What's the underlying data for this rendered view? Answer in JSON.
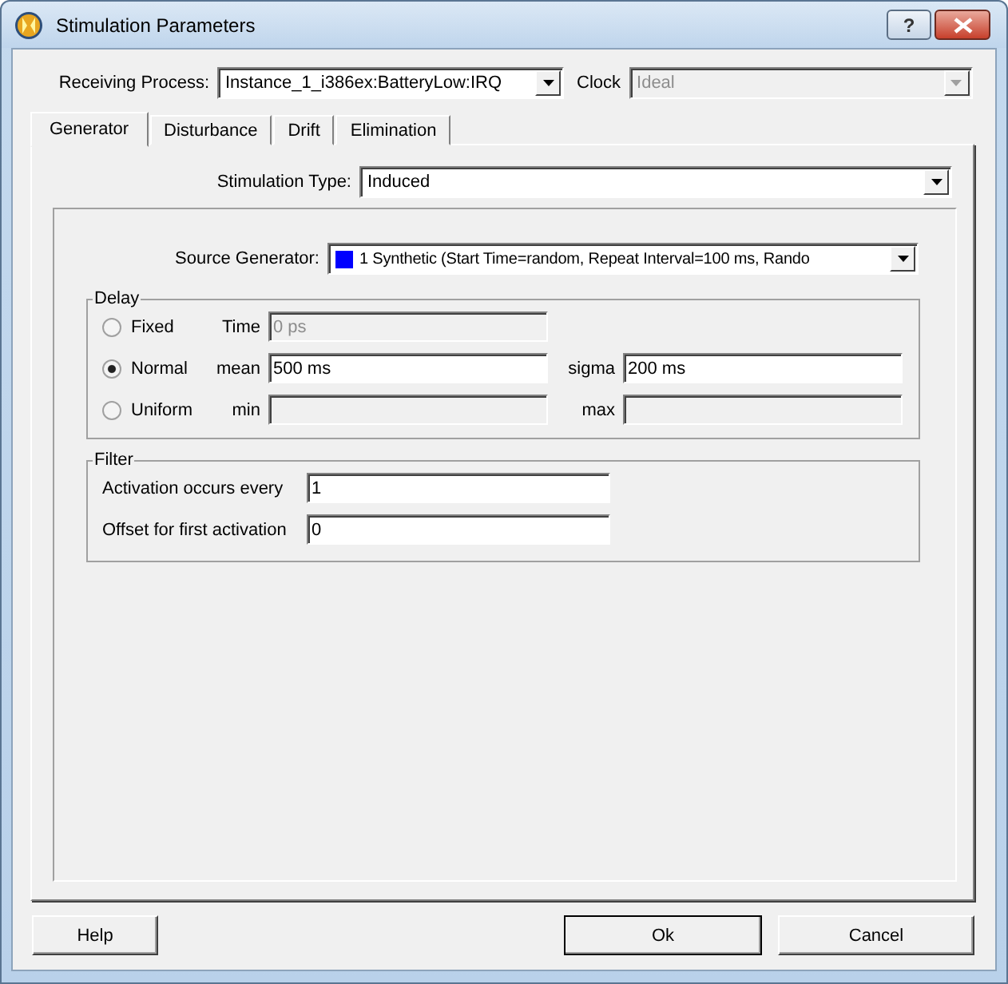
{
  "window": {
    "title": "Stimulation Parameters",
    "help_button": "?"
  },
  "receiving_process": {
    "label": "Receiving Process:",
    "value": "Instance_1_i386ex:BatteryLow:IRQ",
    "disabled": false
  },
  "clock": {
    "label": "Clock",
    "value": "Ideal",
    "disabled": true
  },
  "tabs": [
    {
      "label": "Generator",
      "selected": true
    },
    {
      "label": "Disturbance",
      "selected": false
    },
    {
      "label": "Drift",
      "selected": false
    },
    {
      "label": "Elimination",
      "selected": false
    }
  ],
  "stimulation_type": {
    "label": "Stimulation Type:",
    "value": "Induced",
    "disabled": false
  },
  "source_generator": {
    "label": "Source Generator:",
    "value": "1 Synthetic (Start Time=random, Repeat Interval=100 ms, Rando",
    "color": "#0000ff",
    "disabled": false
  },
  "delay": {
    "title": "Delay",
    "options": [
      {
        "label": "Fixed",
        "selected": false,
        "fields": [
          {
            "label": "Time",
            "value": "0 ps",
            "disabled": true
          }
        ]
      },
      {
        "label": "Normal",
        "selected": true,
        "fields": [
          {
            "label": "mean",
            "value": "500 ms",
            "disabled": false
          },
          {
            "label": "sigma",
            "value": "200 ms",
            "disabled": false
          }
        ]
      },
      {
        "label": "Uniform",
        "selected": false,
        "fields": [
          {
            "label": "min",
            "disabled": true
          },
          {
            "label": "max",
            "disabled": true
          }
        ]
      }
    ]
  },
  "filter": {
    "title": "Filter",
    "fields": [
      {
        "label": "Activation occurs every",
        "value": "1"
      },
      {
        "label": "Offset for first activation",
        "value": "0"
      }
    ]
  },
  "buttons": [
    {
      "label": "Help",
      "default": false
    },
    {
      "label": "Ok",
      "default": true
    },
    {
      "label": "Cancel",
      "default": false
    }
  ]
}
